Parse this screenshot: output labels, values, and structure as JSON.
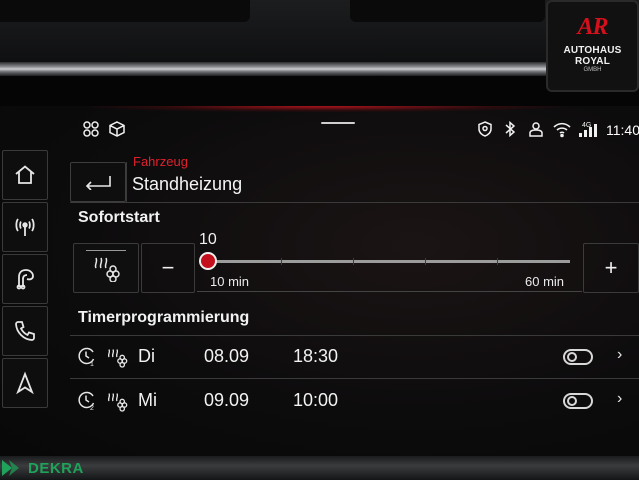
{
  "dealer": {
    "logo_text": "AR",
    "name": "AUTOHAUS ROYAL",
    "sub": "GMBH"
  },
  "status_bar": {
    "left_icons": [
      "app-grid-icon",
      "box-icon"
    ],
    "right_icons": [
      "shield-location-icon",
      "bluetooth-icon",
      "user-icon",
      "wifi-icon",
      "signal-4g-icon"
    ],
    "time": "11:40"
  },
  "rail": {
    "items": [
      {
        "name": "home-icon"
      },
      {
        "name": "radio-icon"
      },
      {
        "name": "media-icon"
      },
      {
        "name": "phone-icon"
      },
      {
        "name": "navigation-icon"
      }
    ]
  },
  "header": {
    "breadcrumb": "Fahrzeug",
    "title": "Standheizung"
  },
  "sofortstart": {
    "heading": "Sofortstart",
    "value": "10",
    "min_label": "10 min",
    "max_label": "60 min",
    "min_value": 10,
    "max_value": 60,
    "current": 10,
    "minus": "−",
    "plus": "+"
  },
  "timer": {
    "heading": "Timerprogrammierung",
    "rows": [
      {
        "index": "1",
        "day": "Di",
        "date": "08.09",
        "time": "18:30",
        "enabled": false
      },
      {
        "index": "2",
        "day": "Mi",
        "date": "09.09",
        "time": "10:00",
        "enabled": false
      }
    ]
  },
  "watermark": "DEKRA",
  "colors": {
    "accent": "#c4101c",
    "breadcrumb": "#e0212d",
    "dekra": "#1fa35a"
  }
}
